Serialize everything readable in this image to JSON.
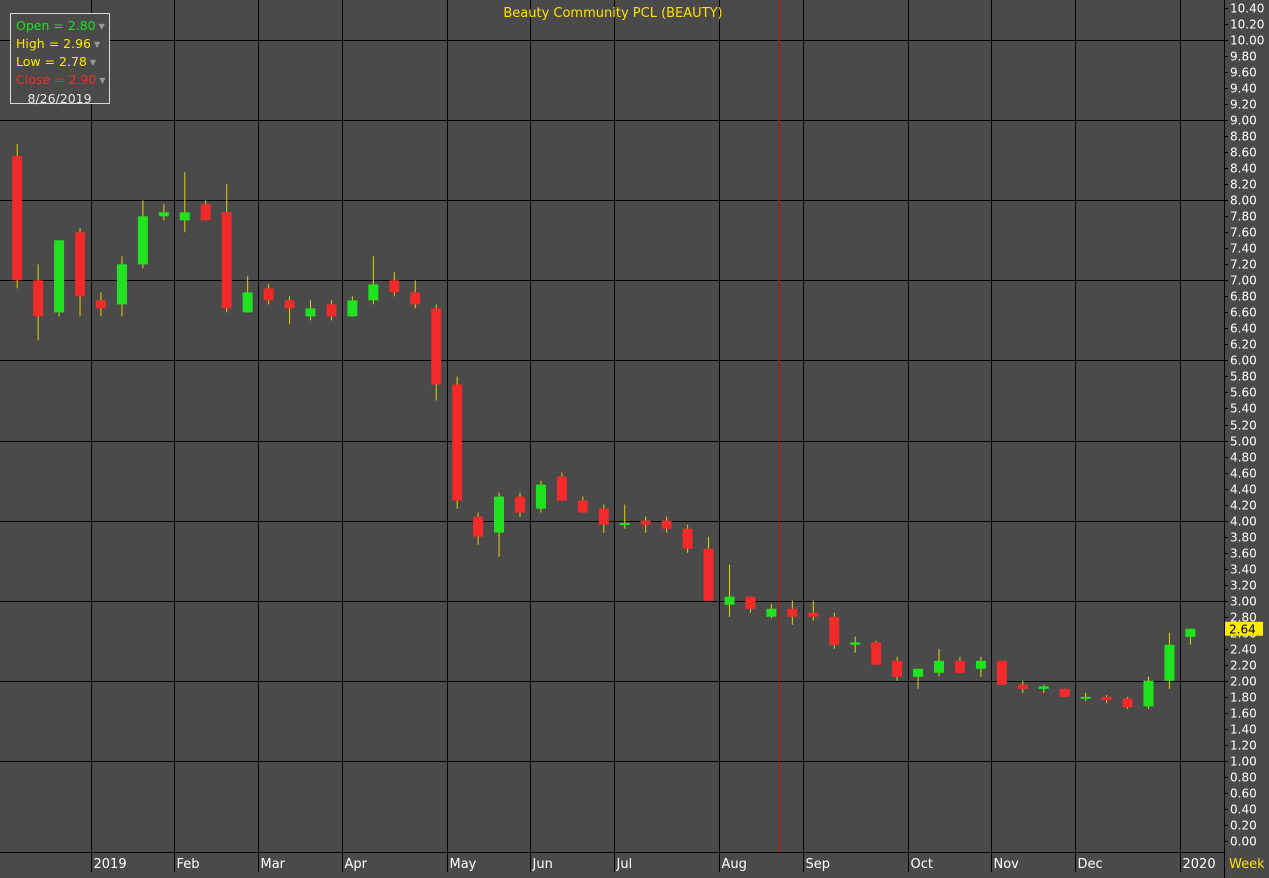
{
  "colors": {
    "background": "#4a4a4a",
    "grid": "#000000",
    "up": "#1ee31e",
    "down": "#f22a2a",
    "wick": "#e4d200",
    "axis_text": "#ffffff",
    "title_text": "#ffe000",
    "crosshair": "#e00000",
    "price_tag": "#ffea00"
  },
  "ohlc_box": {
    "open_label": "Open = 2.80",
    "high_label": "High = 2.96",
    "low_label": "Low = 2.78",
    "close_label": "Close = 2.90",
    "date": "8/26/2019"
  },
  "chart_data": {
    "type": "candlestick",
    "title": "Beauty Community PCL (BEAUTY)",
    "interval_label": "Week",
    "last_price_label": "2.64",
    "ylim": [
      0,
      10.4
    ],
    "y_ticks": [
      0,
      0.2,
      0.4,
      0.6,
      0.8,
      1.0,
      1.2,
      1.4,
      1.6,
      1.8,
      2.0,
      2.2,
      2.4,
      2.6,
      2.8,
      3.0,
      3.2,
      3.4,
      3.6,
      3.8,
      4.0,
      4.2,
      4.4,
      4.6,
      4.8,
      5.0,
      5.2,
      5.4,
      5.6,
      5.8,
      6.0,
      6.2,
      6.4,
      6.6,
      6.8,
      7.0,
      7.2,
      7.4,
      7.6,
      7.8,
      8.0,
      8.2,
      8.4,
      8.6,
      8.8,
      9.0,
      9.2,
      9.4,
      9.6,
      9.8,
      10.0,
      10.2,
      10.4
    ],
    "x_labels": [
      {
        "label": "2019",
        "index": 3.5
      },
      {
        "label": "Feb",
        "index": 7.5
      },
      {
        "label": "Mar",
        "index": 11.5
      },
      {
        "label": "Apr",
        "index": 15.5
      },
      {
        "label": "May",
        "index": 20.5
      },
      {
        "label": "Jun",
        "index": 24.5
      },
      {
        "label": "Jul",
        "index": 28.5
      },
      {
        "label": "Aug",
        "index": 33.5
      },
      {
        "label": "Sep",
        "index": 37.5
      },
      {
        "label": "Oct",
        "index": 42.5
      },
      {
        "label": "Nov",
        "index": 46.5
      },
      {
        "label": "Dec",
        "index": 50.5
      },
      {
        "label": "2020",
        "index": 55.5
      }
    ],
    "crosshair_index": 36.3,
    "candles": [
      {
        "o": 8.55,
        "h": 8.7,
        "l": 6.9,
        "c": 7.0
      },
      {
        "o": 7.0,
        "h": 7.2,
        "l": 6.25,
        "c": 6.55
      },
      {
        "o": 6.6,
        "h": 7.5,
        "l": 6.55,
        "c": 7.5
      },
      {
        "o": 7.6,
        "h": 7.65,
        "l": 6.55,
        "c": 6.8
      },
      {
        "o": 6.75,
        "h": 6.85,
        "l": 6.55,
        "c": 6.65
      },
      {
        "o": 6.7,
        "h": 7.3,
        "l": 6.55,
        "c": 7.2
      },
      {
        "o": 7.2,
        "h": 8.0,
        "l": 7.15,
        "c": 7.8
      },
      {
        "o": 7.8,
        "h": 7.95,
        "l": 7.75,
        "c": 7.85
      },
      {
        "o": 7.75,
        "h": 8.35,
        "l": 7.6,
        "c": 7.85
      },
      {
        "o": 7.95,
        "h": 8.0,
        "l": 7.75,
        "c": 7.75
      },
      {
        "o": 7.85,
        "h": 8.2,
        "l": 6.6,
        "c": 6.65
      },
      {
        "o": 6.6,
        "h": 7.05,
        "l": 6.6,
        "c": 6.85
      },
      {
        "o": 6.9,
        "h": 6.95,
        "l": 6.7,
        "c": 6.75
      },
      {
        "o": 6.75,
        "h": 6.8,
        "l": 6.45,
        "c": 6.65
      },
      {
        "o": 6.55,
        "h": 6.75,
        "l": 6.5,
        "c": 6.65
      },
      {
        "o": 6.7,
        "h": 6.75,
        "l": 6.5,
        "c": 6.55
      },
      {
        "o": 6.55,
        "h": 6.8,
        "l": 6.55,
        "c": 6.75
      },
      {
        "o": 6.75,
        "h": 7.3,
        "l": 6.7,
        "c": 6.95
      },
      {
        "o": 7.0,
        "h": 7.1,
        "l": 6.8,
        "c": 6.85
      },
      {
        "o": 6.85,
        "h": 7.0,
        "l": 6.65,
        "c": 6.7
      },
      {
        "o": 6.65,
        "h": 6.7,
        "l": 5.5,
        "c": 5.7
      },
      {
        "o": 5.7,
        "h": 5.8,
        "l": 4.15,
        "c": 4.25
      },
      {
        "o": 4.05,
        "h": 4.1,
        "l": 3.7,
        "c": 3.8
      },
      {
        "o": 3.85,
        "h": 4.35,
        "l": 3.55,
        "c": 4.3
      },
      {
        "o": 4.3,
        "h": 4.35,
        "l": 4.05,
        "c": 4.1
      },
      {
        "o": 4.15,
        "h": 4.5,
        "l": 4.1,
        "c": 4.45
      },
      {
        "o": 4.55,
        "h": 4.6,
        "l": 4.25,
        "c": 4.25
      },
      {
        "o": 4.25,
        "h": 4.3,
        "l": 4.1,
        "c": 4.1
      },
      {
        "o": 4.15,
        "h": 4.2,
        "l": 3.85,
        "c": 3.95
      },
      {
        "o": 3.95,
        "h": 4.2,
        "l": 3.9,
        "c": 3.97
      },
      {
        "o": 4.0,
        "h": 4.05,
        "l": 3.85,
        "c": 3.95
      },
      {
        "o": 4.0,
        "h": 4.05,
        "l": 3.85,
        "c": 3.9
      },
      {
        "o": 3.9,
        "h": 3.95,
        "l": 3.6,
        "c": 3.65
      },
      {
        "o": 3.65,
        "h": 3.8,
        "l": 3.0,
        "c": 3.0
      },
      {
        "o": 2.95,
        "h": 3.45,
        "l": 2.8,
        "c": 3.05
      },
      {
        "o": 3.05,
        "h": 3.05,
        "l": 2.85,
        "c": 2.9
      },
      {
        "o": 2.8,
        "h": 2.96,
        "l": 2.78,
        "c": 2.9
      },
      {
        "o": 2.9,
        "h": 3.0,
        "l": 2.7,
        "c": 2.8
      },
      {
        "o": 2.85,
        "h": 3.0,
        "l": 2.75,
        "c": 2.8
      },
      {
        "o": 2.8,
        "h": 2.85,
        "l": 2.4,
        "c": 2.45
      },
      {
        "o": 2.45,
        "h": 2.55,
        "l": 2.35,
        "c": 2.48
      },
      {
        "o": 2.48,
        "h": 2.5,
        "l": 2.2,
        "c": 2.2
      },
      {
        "o": 2.25,
        "h": 2.3,
        "l": 2.0,
        "c": 2.05
      },
      {
        "o": 2.05,
        "h": 2.15,
        "l": 1.9,
        "c": 2.15
      },
      {
        "o": 2.1,
        "h": 2.4,
        "l": 2.05,
        "c": 2.25
      },
      {
        "o": 2.25,
        "h": 2.3,
        "l": 2.1,
        "c": 2.1
      },
      {
        "o": 2.15,
        "h": 2.3,
        "l": 2.05,
        "c": 2.25
      },
      {
        "o": 2.25,
        "h": 2.25,
        "l": 1.95,
        "c": 1.95
      },
      {
        "o": 1.95,
        "h": 2.0,
        "l": 1.85,
        "c": 1.9
      },
      {
        "o": 1.9,
        "h": 1.95,
        "l": 1.85,
        "c": 1.93
      },
      {
        "o": 1.9,
        "h": 1.9,
        "l": 1.8,
        "c": 1.8
      },
      {
        "o": 1.8,
        "h": 1.85,
        "l": 1.75,
        "c": 1.8
      },
      {
        "o": 1.8,
        "h": 1.82,
        "l": 1.72,
        "c": 1.76
      },
      {
        "o": 1.78,
        "h": 1.8,
        "l": 1.65,
        "c": 1.67
      },
      {
        "o": 1.68,
        "h": 2.05,
        "l": 1.65,
        "c": 2.0
      },
      {
        "o": 2.0,
        "h": 2.6,
        "l": 1.9,
        "c": 2.45
      },
      {
        "o": 2.55,
        "h": 2.65,
        "l": 2.45,
        "c": 2.65
      }
    ]
  }
}
